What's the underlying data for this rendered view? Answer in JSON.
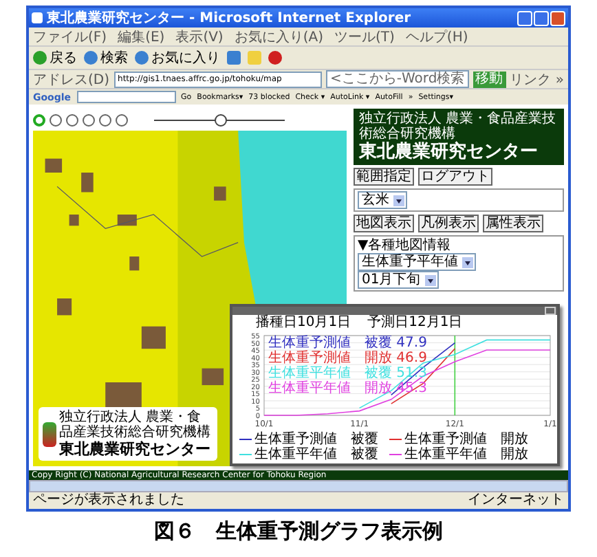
{
  "window": {
    "title": "東北農業研究センター - Microsoft Internet Explorer"
  },
  "menu_bar": [
    "ファイル(F)",
    "編集(E)",
    "表示(V)",
    "お気に入り(A)",
    "ツール(T)",
    "ヘルプ(H)"
  ],
  "toolbar": [
    "戻る",
    "検索",
    "お気に入り"
  ],
  "address_bar": {
    "label": "アドレス(D)",
    "url": "http://gis1.tnaes.affrc.go.jp/tohoku/map",
    "search_placeholder": "<ここから-Word検索",
    "go": "移動",
    "links": "リンク »"
  },
  "google_bar": {
    "logo": "Google",
    "items": [
      "Go",
      "Bookmarks▾",
      "73 blocked",
      "Check ▾",
      "AutoLink ▾",
      "AutoFill",
      "»",
      "Settings▾"
    ]
  },
  "map": {
    "zoom_slider": {
      "level": 0.5
    },
    "logo": {
      "org": "独立行政法人 農業・食品産業技術総合研究機構",
      "name": "東北農業研究センター"
    }
  },
  "side_panel": {
    "header": {
      "org": "独立行政法人 農業・食品産業技術総合研究機構",
      "name": "東北農業研究センター"
    },
    "buttons_top": [
      "範囲指定",
      "ログアウト"
    ],
    "crop_select": "玄米",
    "buttons_mid": [
      "地図表示",
      "凡例表示",
      "属性表示"
    ],
    "info_title": "▼各種地図情報",
    "selects": [
      "生体重予平年値",
      "01月下旬"
    ]
  },
  "chart_window": {
    "heading": [
      "播種日10月1日",
      "予測日12月1日"
    ],
    "legend_top": [
      {
        "text": "生体重予測値　被覆 47.9",
        "color": "#3030c0"
      },
      {
        "text": "生体重予測値　開放 46.9",
        "color": "#e03030"
      },
      {
        "text": "生体重平年値　被覆 51.3",
        "color": "#40e0e0"
      },
      {
        "text": "生体重平年値　開放 45.3",
        "color": "#e040e0"
      }
    ],
    "chart_data": {
      "type": "line",
      "categories": [
        "10/1",
        null,
        null,
        "11/1",
        null,
        null,
        "12/1",
        null,
        null,
        "1/1"
      ],
      "yticks": [
        0,
        5,
        10,
        15,
        20,
        25,
        30,
        35,
        40,
        45,
        50,
        55
      ],
      "ylim": [
        0,
        55
      ],
      "grid": true,
      "series": [
        {
          "name": "生体重予測値　被覆",
          "color": "#3030c0",
          "values": [
            null,
            null,
            null,
            null,
            14,
            33,
            50,
            null,
            null,
            null
          ]
        },
        {
          "name": "生体重予測値　開放",
          "color": "#e03030",
          "values": [
            null,
            null,
            null,
            null,
            8,
            22,
            46,
            null,
            null,
            null
          ]
        },
        {
          "name": "生体重平年値　被覆",
          "color": "#40e0e0",
          "values": [
            null,
            null,
            null,
            5,
            17,
            36,
            42,
            52,
            52,
            52
          ]
        },
        {
          "name": "生体重平年値　開放",
          "color": "#e040e0",
          "values": [
            0,
            0,
            1,
            3,
            11,
            27,
            37,
            45,
            45,
            45
          ]
        }
      ],
      "annotations": [
        {
          "x": "12/1"
        }
      ]
    }
  },
  "footer": "Copy Right (C) National Agricultural Research Center for Tohoku Region",
  "status_bar": {
    "text": "ページが表示されました",
    "zone": "インターネット"
  },
  "caption": "図６　生体重予測グラフ表示例"
}
